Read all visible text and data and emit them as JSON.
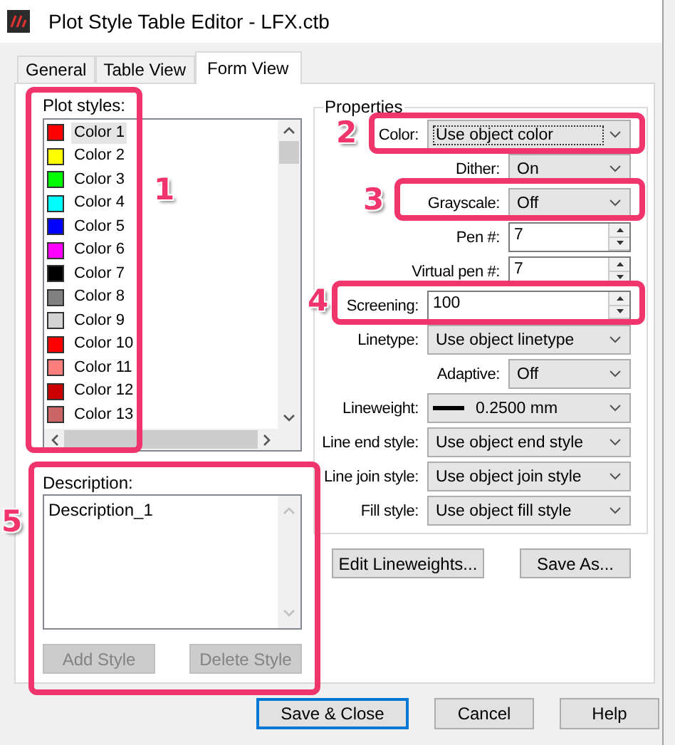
{
  "window": {
    "title": "Plot Style Table Editor - LFX.ctb"
  },
  "tabs": [
    {
      "label": "General",
      "selected": false
    },
    {
      "label": "Table View",
      "selected": false
    },
    {
      "label": "Form View",
      "selected": true
    }
  ],
  "plot_styles": {
    "label": "Plot styles:",
    "items": [
      {
        "name": "Color 1",
        "color": "#ff0000",
        "selected": true
      },
      {
        "name": "Color 2",
        "color": "#ffff00",
        "selected": false
      },
      {
        "name": "Color 3",
        "color": "#00ff00",
        "selected": false
      },
      {
        "name": "Color 4",
        "color": "#00ffff",
        "selected": false
      },
      {
        "name": "Color 5",
        "color": "#0000ff",
        "selected": false
      },
      {
        "name": "Color 6",
        "color": "#ff00ff",
        "selected": false
      },
      {
        "name": "Color 7",
        "color": "#000000",
        "selected": false
      },
      {
        "name": "Color 8",
        "color": "#808080",
        "selected": false
      },
      {
        "name": "Color 9",
        "color": "#d3d3d3",
        "selected": false
      },
      {
        "name": "Color 10",
        "color": "#ff0000",
        "selected": false
      },
      {
        "name": "Color 11",
        "color": "#ff7f7f",
        "selected": false
      },
      {
        "name": "Color 12",
        "color": "#cc0000",
        "selected": false
      },
      {
        "name": "Color 13",
        "color": "#cc6666",
        "selected": false
      }
    ]
  },
  "description": {
    "label": "Description:",
    "value": "Description_1"
  },
  "style_buttons": [
    {
      "label": "Add Style",
      "disabled": true
    },
    {
      "label": "Delete Style",
      "disabled": true
    }
  ],
  "properties": {
    "title": "Properties",
    "fields": [
      {
        "label": "Color:",
        "kind": "dropdown",
        "value": "Use object color",
        "focused": true
      },
      {
        "label": "Dither:",
        "kind": "dropdown",
        "value": "On",
        "focused": false
      },
      {
        "label": "Grayscale:",
        "kind": "dropdown",
        "value": "Off",
        "focused": false
      },
      {
        "label": "Pen #:",
        "kind": "spin",
        "value": "7",
        "focused": false
      },
      {
        "label": "Virtual pen #:",
        "kind": "spin",
        "value": "7",
        "focused": false
      },
      {
        "label": "Screening:",
        "kind": "spin",
        "value": "100",
        "focused": false
      },
      {
        "label": "Linetype:",
        "kind": "dropdown",
        "value": "Use object linetype",
        "focused": false
      },
      {
        "label": "Adaptive:",
        "kind": "dropdown",
        "value": "Off",
        "focused": false
      },
      {
        "label": "Lineweight:",
        "kind": "lineweight",
        "value": "0.2500 mm",
        "focused": false
      },
      {
        "label": "Line end style:",
        "kind": "dropdown",
        "value": "Use object end style",
        "focused": false
      },
      {
        "label": "Line join style:",
        "kind": "dropdown",
        "value": "Use object join style",
        "focused": false
      },
      {
        "label": "Fill style:",
        "kind": "dropdown",
        "value": "Use object fill style",
        "focused": false
      }
    ]
  },
  "property_buttons": [
    "Edit Lineweights...",
    "Save As..."
  ],
  "dialog_buttons": [
    {
      "label": "Save & Close",
      "default": true
    },
    {
      "label": "Cancel",
      "default": false
    },
    {
      "label": "Help",
      "default": false
    }
  ],
  "callouts": [
    {
      "number": "1"
    },
    {
      "number": "2"
    },
    {
      "number": "3"
    },
    {
      "number": "4"
    },
    {
      "number": "5"
    }
  ]
}
